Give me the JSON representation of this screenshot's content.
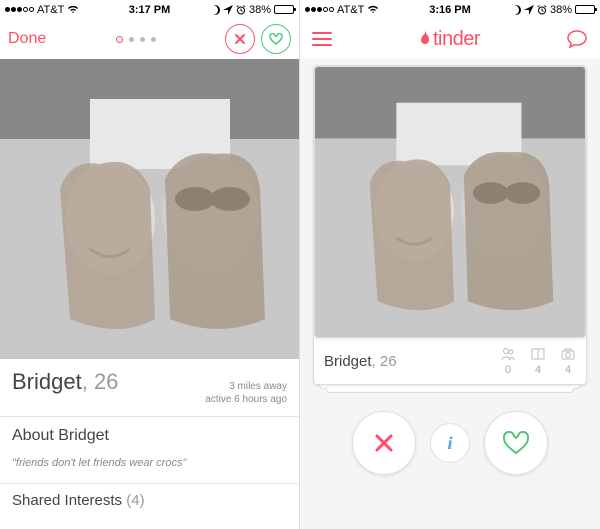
{
  "left": {
    "status": {
      "carrier": "AT&T",
      "time": "3:17 PM",
      "battery": "38%"
    },
    "header": {
      "done": "Done"
    },
    "profile": {
      "name": "Bridget",
      "age_suffix": ", 26",
      "distance": "3 miles away",
      "active": "active 6 hours ago",
      "about_heading": "About Bridget",
      "bio": "\"friends don't let friends wear crocs\"",
      "shared_label": "Shared Interests",
      "shared_count": "(4)"
    }
  },
  "right": {
    "status": {
      "carrier": "AT&T",
      "time": "3:16 PM",
      "battery": "38%"
    },
    "logo": "tinder",
    "card": {
      "name": "Bridget",
      "age_suffix": ", 26",
      "stats": {
        "friends": "0",
        "interests": "4",
        "photos": "4"
      }
    },
    "info_label": "i"
  },
  "colors": {
    "brand": "#fd5068",
    "like": "#4fc778",
    "info": "#5aa0e8"
  }
}
